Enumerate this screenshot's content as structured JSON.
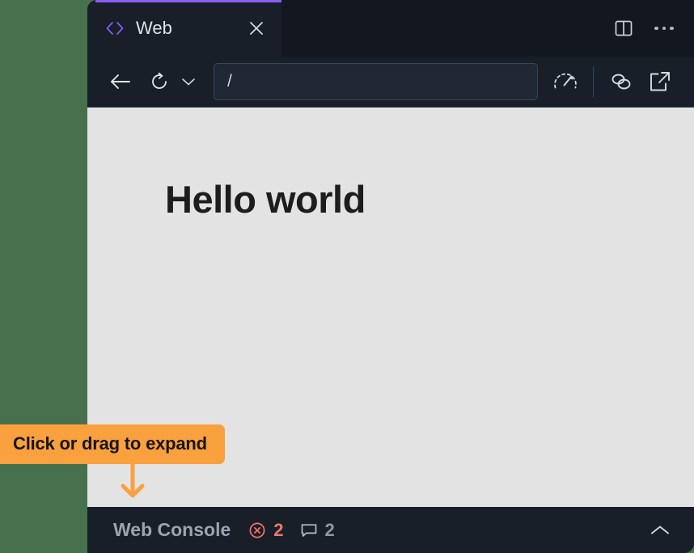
{
  "window": {
    "background_color": "#47704c",
    "panel_background": "#131820"
  },
  "tab_bar": {
    "tabs": [
      {
        "label": "Web",
        "icon": "code-brackets-icon",
        "active": true,
        "accent_color": "#8b5cf6",
        "code_glyph": "‹›",
        "close_label": "✕"
      }
    ],
    "actions": [
      {
        "name": "split-pane-icon",
        "label": "Split pane"
      },
      {
        "name": "more-options-icon",
        "label": "More options"
      }
    ]
  },
  "toolbar": {
    "back_label": "Back",
    "reload_label": "Reload",
    "reload_menu_label": "Reload options",
    "address": {
      "value": "/",
      "placeholder": "/"
    },
    "actions": [
      {
        "name": "performance-gauge-icon",
        "label": "Performance"
      },
      {
        "name": "link-icon",
        "label": "Copy link"
      },
      {
        "name": "open-external-icon",
        "label": "Open in browser"
      }
    ]
  },
  "viewport": {
    "background_color": "#e3e3e3",
    "heading": "Hello world"
  },
  "console_bar": {
    "title": "Web Console",
    "background_color": "#181f28",
    "badges": [
      {
        "name": "error-badge",
        "icon": "error-circle-x-icon",
        "count": "2",
        "color": "#f3756a"
      },
      {
        "name": "message-badge",
        "icon": "speech-bubble-icon",
        "count": "2",
        "color": "#8e99a8"
      }
    ],
    "expand_icon": "chevron-up-icon",
    "expand_label": "Expand console"
  },
  "callout": {
    "text": "Click or drag to expand",
    "background_color": "#f9a03f",
    "text_color": "#161616",
    "arrow_direction": "down"
  }
}
